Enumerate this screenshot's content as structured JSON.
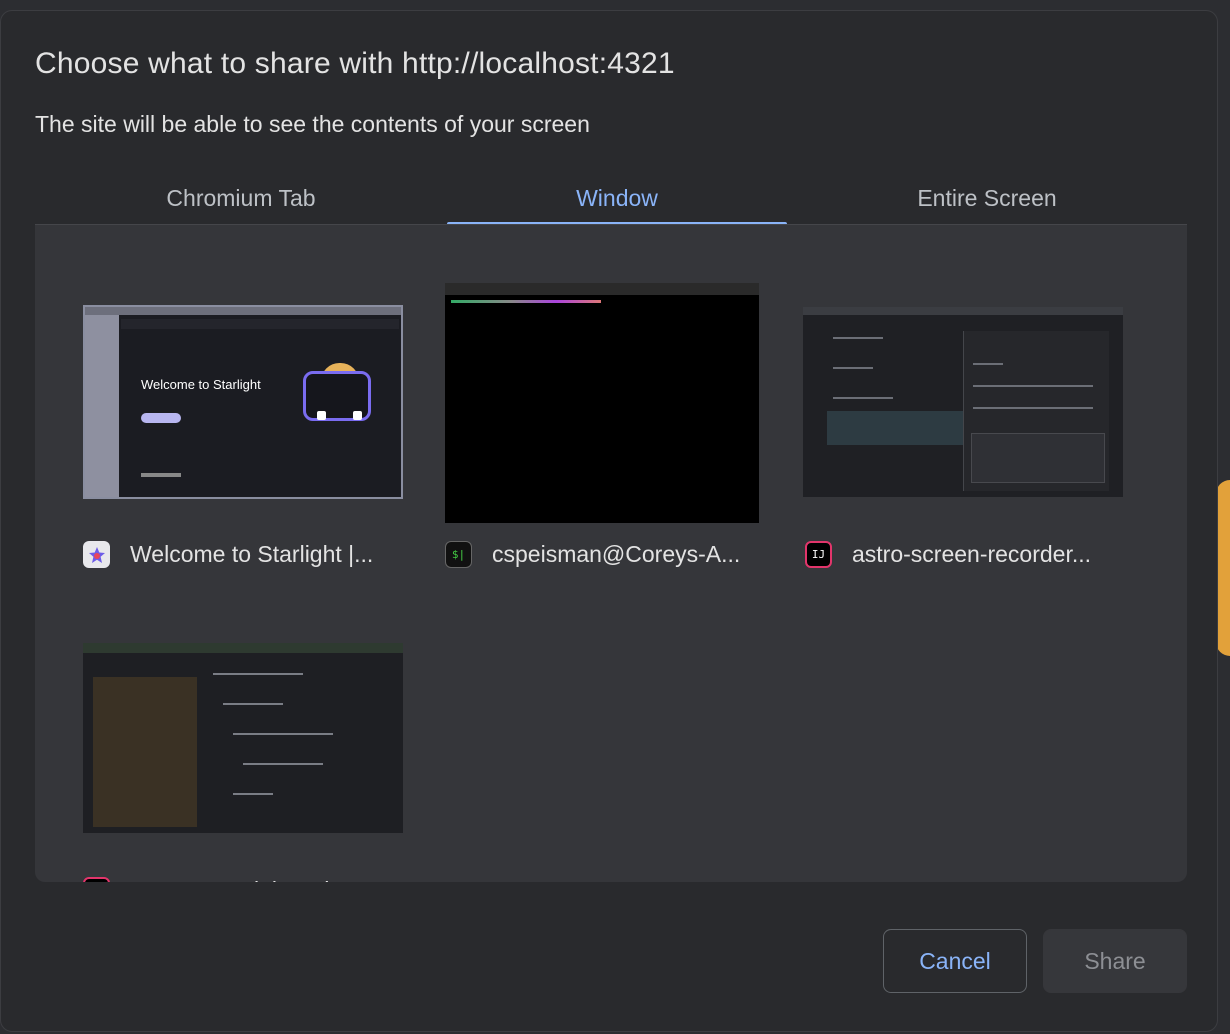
{
  "dialog": {
    "title": "Choose what to share with http://localhost:4321",
    "subtitle": "The site will be able to see the contents of your screen"
  },
  "tabs": [
    {
      "label": "Chromium Tab",
      "selected": false
    },
    {
      "label": "Window",
      "selected": true
    },
    {
      "label": "Entire Screen",
      "selected": false
    }
  ],
  "windows": [
    {
      "title": "Welcome to Starlight |...",
      "icon": "starlight-browser-icon",
      "thumb_text": "Welcome to Starlight"
    },
    {
      "title": "cspeisman@Coreys-A...",
      "icon": "terminal-icon",
      "icon_text": "$|"
    },
    {
      "title": "astro-screen-recorder...",
      "icon": "intellij-icon",
      "icon_text": "IJ"
    },
    {
      "title": "extraterrestrial-earth",
      "icon": "intellij-icon",
      "icon_text": "IJ"
    }
  ],
  "buttons": {
    "cancel": "Cancel",
    "share": "Share"
  },
  "colors": {
    "accent": "#8ab4f8",
    "dialog_bg": "#292a2d",
    "panel_bg": "#35363a"
  }
}
